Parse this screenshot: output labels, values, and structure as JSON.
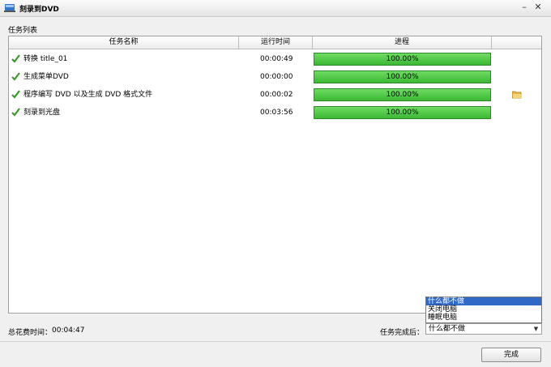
{
  "window": {
    "title": "刻录到DVD"
  },
  "section_label": "任务列表",
  "columns": [
    "任务名称",
    "运行时间",
    "进程"
  ],
  "tasks": [
    {
      "name": "转换 title_01",
      "time": "00:00:49",
      "progress": "100.00%"
    },
    {
      "name": "生成菜单DVD",
      "time": "00:00:00",
      "progress": "100.00%"
    },
    {
      "name": "程序编写 DVD 以及生成 DVD 格式文件",
      "time": "00:00:02",
      "progress": "100.00%"
    },
    {
      "name": "刻录到光盘",
      "time": "00:03:56",
      "progress": "100.00%"
    }
  ],
  "footer": {
    "total_label": "总花费时间：",
    "total_value": "00:04:47",
    "after_label": "任务完成后：",
    "after_selected": "什么都不做",
    "after_options": [
      "什么都不做",
      "关闭电脑",
      "睡眠电脑"
    ]
  },
  "done_button": "完成",
  "icons": {
    "task_status": "check-icon",
    "folder": "folder-icon"
  },
  "colors": {
    "progress": "#4cc842",
    "check": "#3a9a2a",
    "selection": "#3169c6"
  }
}
